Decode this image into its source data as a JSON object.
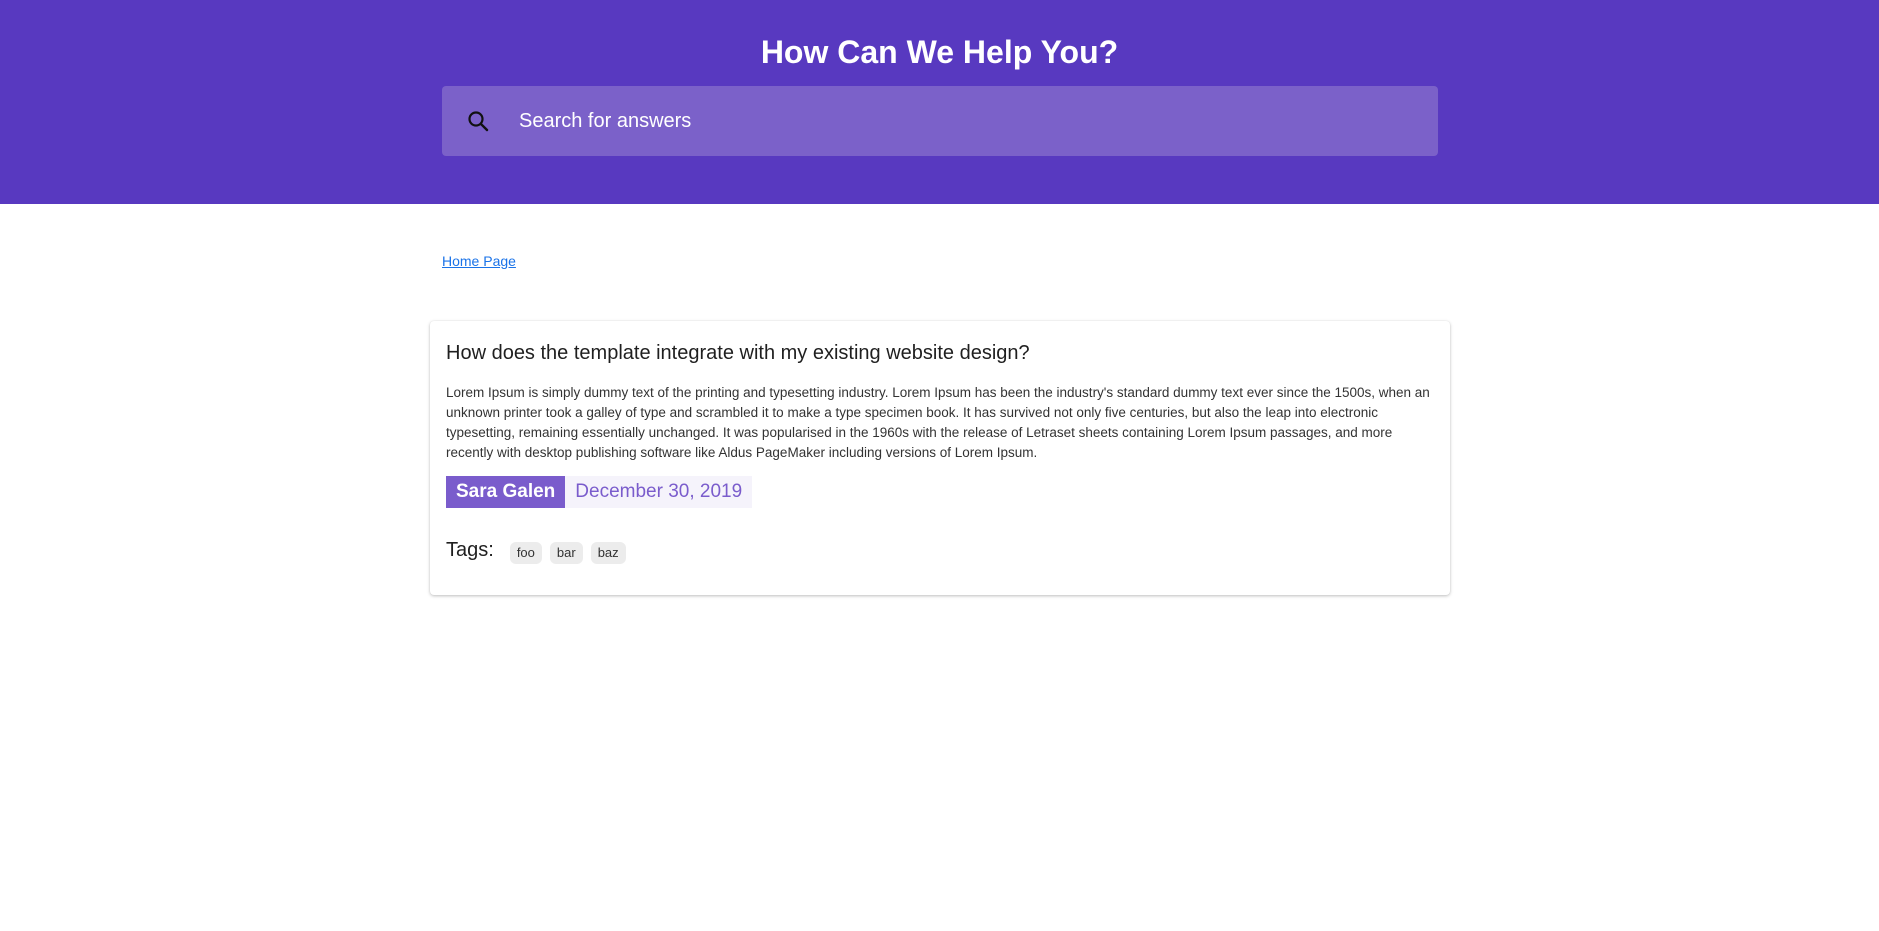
{
  "hero": {
    "title": "How Can We Help You?",
    "background_color": "#5839c0",
    "search": {
      "icon": "search-icon",
      "placeholder": "Search for answers",
      "value": ""
    }
  },
  "breadcrumb": {
    "home_label": "Home Page",
    "link_color": "#1a73e8"
  },
  "article": {
    "title": "How does the template integrate with my existing website design?",
    "body": "Lorem Ipsum is simply dummy text of the printing and typesetting industry. Lorem Ipsum has been the industry's standard dummy text ever since the 1500s, when an unknown printer took a galley of type and scrambled it to make a type specimen book. It has survived not only five centuries, but also the leap into electronic typesetting, remaining essentially unchanged. It was popularised in the 1960s with the release of Letraset sheets containing Lorem Ipsum passages, and more recently with desktop publishing software like Aldus PageMaker including versions of Lorem Ipsum.",
    "author": "Sara Galen",
    "date": "December 30, 2019",
    "accent_color": "#7a5ccc",
    "tags_label": "Tags:",
    "tags": [
      "foo",
      "bar",
      "baz"
    ]
  }
}
